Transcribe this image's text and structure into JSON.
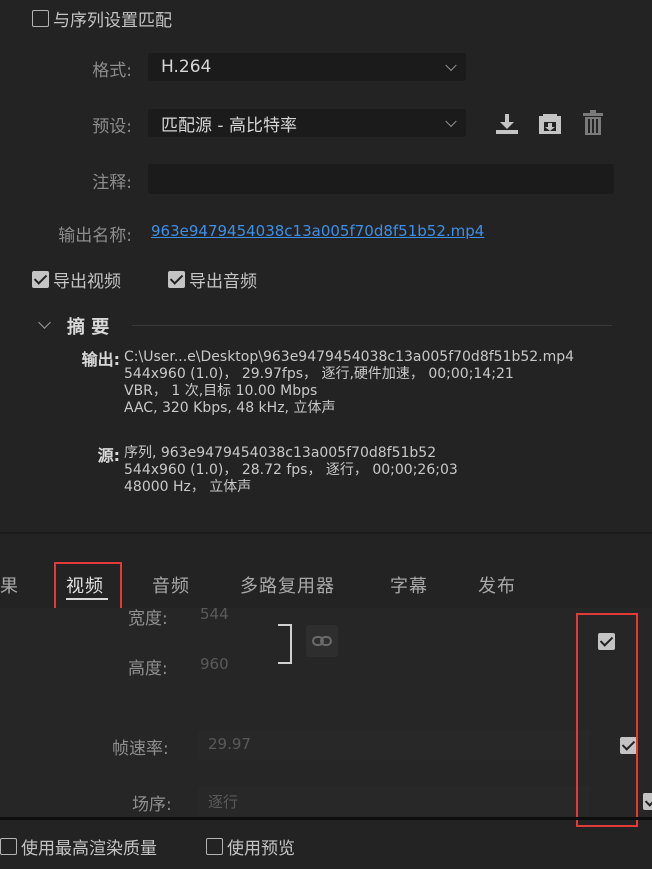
{
  "top": {
    "match_sequence_label": "与序列设置匹配",
    "match_sequence_checked": false
  },
  "format": {
    "label": "格式:",
    "value": "H.264"
  },
  "preset": {
    "label": "预设:",
    "value": "匹配源 - 高比特率"
  },
  "comment": {
    "label": "注释:",
    "value": ""
  },
  "output_name": {
    "label": "输出名称:",
    "value": "963e9479454038c13a005f70d8f51b52.mp4"
  },
  "export_options": {
    "export_video_label": "导出视频",
    "export_video_checked": true,
    "export_audio_label": "导出音频",
    "export_audio_checked": true
  },
  "summary": {
    "title": "摘 要",
    "output_label": "输出:",
    "output_lines": [
      "C:\\User...e\\Desktop\\963e9479454038c13a005f70d8f51b52.mp4",
      "544x960 (1.0)， 29.97fps， 逐行,硬件加速， 00;00;14;21",
      "VBR， 1 次,目标 10.00 Mbps",
      "AAC, 320 Kbps, 48  kHz, 立体声"
    ],
    "source_label": "源:",
    "source_lines": [
      "序列, 963e9479454038c13a005f70d8f51b52",
      "544x960 (1.0)， 28.72 fps， 逐行， 00;00;26;03",
      "48000 Hz， 立体声"
    ]
  },
  "tabs": {
    "effects_partial": "果",
    "video": "视频",
    "audio": "音频",
    "multiplexer": "多路复用器",
    "captions": "字幕",
    "publish": "发布"
  },
  "video_settings": {
    "width_label": "宽度:",
    "width_value": "544",
    "height_label": "高度:",
    "height_value": "960",
    "framerate_label": "帧速率:",
    "framerate_value": "29.97",
    "field_order_label": "场序:",
    "field_order_value": "逐行"
  },
  "bottom": {
    "max_render_label": "使用最高渲染质量",
    "preview_label": "使用预览"
  }
}
